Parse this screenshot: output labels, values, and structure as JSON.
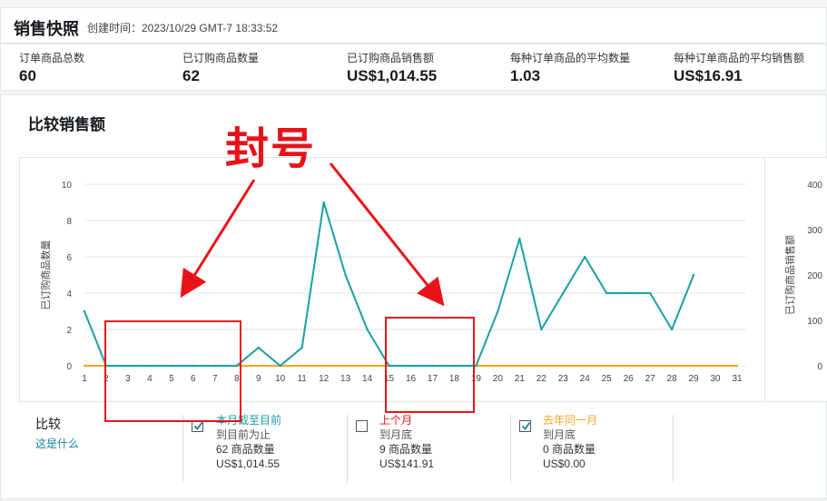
{
  "header": {
    "title": "销售快照",
    "created": "创建时间：2023/10/29 GMT-7 18:33:52"
  },
  "stats": [
    {
      "label": "订单商品总数",
      "value": "60"
    },
    {
      "label": "已订购商品数量",
      "value": "62"
    },
    {
      "label": "已订购商品销售额",
      "value": "US$1,014.55"
    },
    {
      "label": "每种订单商品的平均数量",
      "value": "1.03"
    },
    {
      "label": "每种订单商品的平均销售额",
      "value": "US$16.91"
    }
  ],
  "compare": {
    "title": "比较销售额"
  },
  "chart_data": {
    "type": "line",
    "x": [
      1,
      2,
      3,
      4,
      5,
      6,
      7,
      8,
      9,
      10,
      11,
      12,
      13,
      14,
      15,
      16,
      17,
      18,
      19,
      20,
      21,
      22,
      23,
      24,
      25,
      26,
      27,
      28,
      29,
      30,
      31
    ],
    "x_tick_labels": [
      "1",
      "2",
      "3",
      "4",
      "5",
      "6",
      "7",
      "8",
      "9",
      "10",
      "11",
      "12",
      "13",
      "14",
      "15",
      "16",
      "17",
      "18",
      "19",
      "20",
      "21",
      "22",
      "23",
      "24",
      "25",
      "26",
      "27",
      "28",
      "29",
      "30",
      "31"
    ],
    "ylabel": "已订购商品数量",
    "y2label": "已订购商品销售额",
    "ylim": [
      0,
      10
    ],
    "y2lim": [
      0,
      400
    ],
    "y_ticks": [
      0,
      2,
      4,
      6,
      8,
      10
    ],
    "y2_ticks": [
      0,
      100,
      200,
      300,
      400
    ],
    "grid": true,
    "series": [
      {
        "name": "本月截至目前",
        "color": "#1a9fa5",
        "values": [
          3,
          0,
          0,
          0,
          0,
          0,
          0,
          0,
          1,
          0,
          1,
          9,
          5,
          2,
          0,
          0,
          0,
          0,
          0,
          3,
          7,
          2,
          4,
          6,
          4,
          4,
          4,
          2,
          5
        ]
      },
      {
        "name": "去年同一月",
        "color": "#f5a623",
        "values": [
          0,
          0,
          0,
          0,
          0,
          0,
          0,
          0,
          0,
          0,
          0,
          0,
          0,
          0,
          0,
          0,
          0,
          0,
          0,
          0,
          0,
          0,
          0,
          0,
          0,
          0,
          0,
          0,
          0,
          0,
          0
        ]
      }
    ]
  },
  "legend": {
    "title": "比较",
    "link": "这是什么",
    "items": [
      {
        "name": "本月截至目前",
        "sub": "到目前为止",
        "qty": "62 商品数量",
        "amount": "US$1,014.55",
        "color": "#1a9fa5",
        "checked": true
      },
      {
        "name": "上个月",
        "sub": "到月底",
        "qty": "9 商品数量",
        "amount": "US$141.91",
        "color": "#e8131a",
        "checked": false
      },
      {
        "name": "去年同一月",
        "sub": "到月底",
        "qty": "0 商品数量",
        "amount": "US$0.00",
        "color": "#f5a623",
        "checked": true
      }
    ]
  },
  "annotation": {
    "text": "封号",
    "color": "#e8131a"
  }
}
